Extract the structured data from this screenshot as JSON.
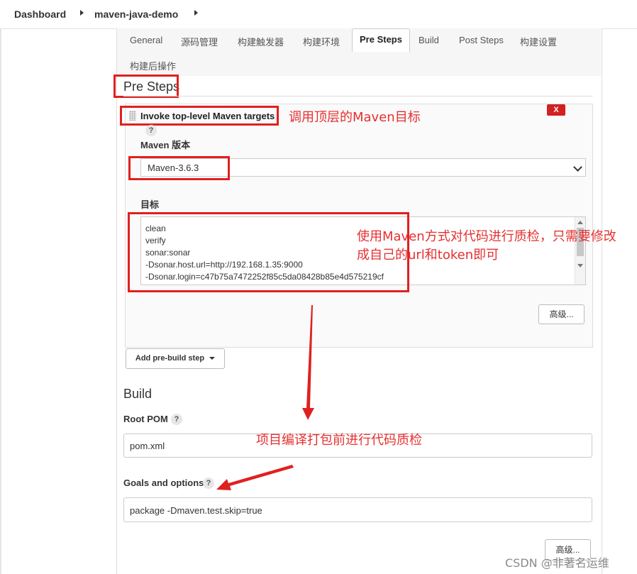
{
  "breadcrumb": {
    "items": [
      {
        "label": "Dashboard"
      },
      {
        "label": "maven-java-demo"
      }
    ]
  },
  "tabs": [
    {
      "label": "General"
    },
    {
      "label": "源码管理"
    },
    {
      "label": "构建触发器"
    },
    {
      "label": "构建环境"
    },
    {
      "label": "Pre Steps",
      "active": true
    },
    {
      "label": "Build"
    },
    {
      "label": "Post Steps"
    },
    {
      "label": "构建设置"
    },
    {
      "label": "构建后操作"
    }
  ],
  "pre_steps": {
    "title": "Pre Steps",
    "step": {
      "title": "Invoke top-level Maven targets",
      "help": "?",
      "delete_label": "X",
      "maven_version_label": "Maven 版本",
      "maven_version_value": "Maven-3.6.3",
      "goals_label": "目标",
      "goals_lines": [
        "clean",
        "verify",
        "sonar:sonar",
        "-Dsonar.host.url=http://192.168.1.35:9000",
        "-Dsonar.login=c47b75a7472252f85c5da08428b85e4d575219cf"
      ],
      "advanced_label": "高级..."
    },
    "add_step_label": "Add pre-build step"
  },
  "build": {
    "title": "Build",
    "root_pom_label": "Root POM",
    "root_pom_value": "pom.xml",
    "goals_options_label": "Goals and options",
    "goals_options_value": "package -Dmaven.test.skip=true",
    "advanced_label": "高级...",
    "help": "?"
  },
  "annotations": {
    "maven_targets": "调用顶层的Maven目标",
    "quality_line1": "使用Maven方式对代码进行质检，只需要修改",
    "quality_line2": "成自己的url和token即可",
    "before_build": "项目编译打包前进行代码质检"
  },
  "watermark": "CSDN @非著名运维",
  "colors": {
    "annotation_red": "#e02020",
    "delete_button": "#d32020"
  }
}
